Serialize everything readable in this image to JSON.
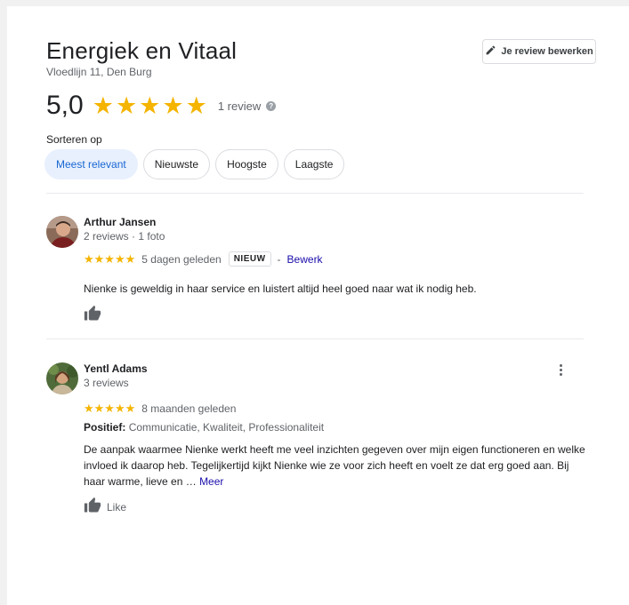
{
  "place": {
    "name": "Energiek en Vitaal",
    "address": "Vloedlijn 11, Den Burg"
  },
  "edit_button": {
    "label": "Je review bewerken",
    "icon": "pencil-icon"
  },
  "rating": {
    "value": "5,0",
    "stars": 5,
    "count_label": "1 review",
    "help_icon": "?"
  },
  "sort": {
    "label": "Sorteren op",
    "options": [
      {
        "label": "Meest relevant",
        "selected": true
      },
      {
        "label": "Nieuwste",
        "selected": false
      },
      {
        "label": "Hoogste",
        "selected": false
      },
      {
        "label": "Laagste",
        "selected": false
      }
    ]
  },
  "colors": {
    "star": "#f4b400",
    "link": "#1a0dab",
    "chip_active_bg": "#e8f0fe",
    "chip_active_text": "#1967d2"
  },
  "reviews": [
    {
      "name": "Arthur Jansen",
      "meta": "2 reviews · 1 foto",
      "stars": "★★★★★",
      "time": "5 dagen geleden",
      "badge": "NIEUW",
      "separator": "-",
      "edit_label": "Bewerk",
      "text": "Nienke is geweldig in haar service en luistert altijd heel goed naar wat ik nodig heb.",
      "like_icon": "thumbs-up-icon"
    },
    {
      "name": "Yentl Adams",
      "meta": "3 reviews",
      "stars": "★★★★★",
      "time": "8 maanden geleden",
      "positive_label": "Positief:",
      "positive_values": "Communicatie, Kwaliteit, Professionaliteit",
      "text": "De aanpak waarmee Nienke werkt heeft me veel inzichten gegeven over mijn eigen functioneren en welke invloed ik daarop heb. Tegelijkertijd kijkt Nienke wie ze voor zich heeft en voelt ze dat erg goed aan. Bij haar warme, lieve en … ",
      "more_label": "Meer",
      "like_label": "Like",
      "like_icon": "thumbs-up-icon",
      "menu_icon": "more-vertical-icon"
    }
  ]
}
